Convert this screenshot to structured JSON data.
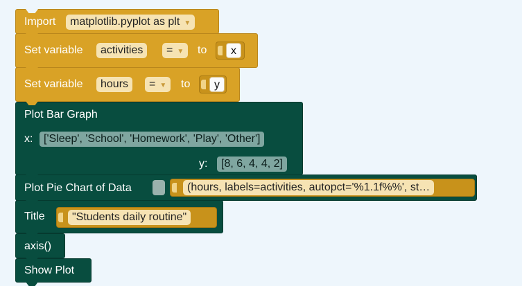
{
  "blocks": {
    "import": {
      "label": "Import",
      "module": "matplotlib.pyplot as plt"
    },
    "set_activities": {
      "label": "Set variable",
      "var": "activities",
      "op": "=",
      "to": "to",
      "value": "x"
    },
    "set_hours": {
      "label": "Set variable",
      "var": "hours",
      "op": "=",
      "to": "to",
      "value": "y"
    },
    "bar": {
      "label": "Plot Bar Graph",
      "x_label": "x:",
      "x_value": "['Sleep', 'School', 'Homework', 'Play', 'Other']",
      "y_label": "y:",
      "y_value": "[8, 6, 4, 4, 2]"
    },
    "pie": {
      "label": "Plot Pie Chart of Data",
      "args": "(hours, labels=activities, autopct='%1.1f%%', st…"
    },
    "title": {
      "label": "Title",
      "value": "\"Students daily routine\""
    },
    "axis": {
      "label": "axis()"
    },
    "show": {
      "label": "Show Plot"
    }
  },
  "colors": {
    "gold": "#d9a226",
    "green": "#084d3f",
    "background": "#eef6fc"
  }
}
